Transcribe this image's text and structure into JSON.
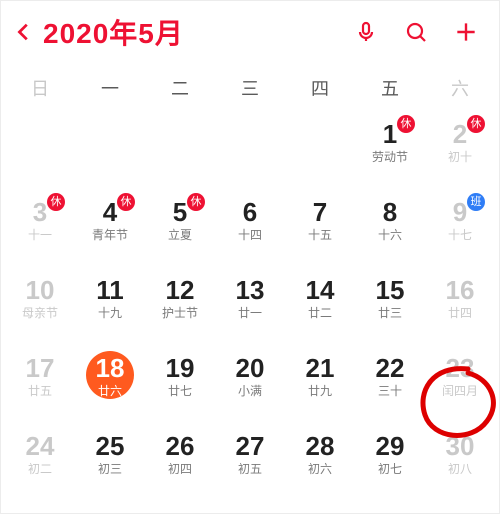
{
  "header": {
    "title": "2020年5月",
    "icons": {
      "back": "chevron-left",
      "mic": "microphone",
      "search": "magnifier",
      "add": "plus"
    }
  },
  "weekdays": [
    "日",
    "一",
    "二",
    "三",
    "四",
    "五",
    "六"
  ],
  "badge_labels": {
    "rest": "休",
    "work": "班"
  },
  "colors": {
    "accent": "#e13",
    "today": "#ff5a1f",
    "work_badge": "#2f7df6"
  },
  "rows": [
    [
      null,
      null,
      null,
      null,
      null,
      {
        "n": "1",
        "s": "劳动节",
        "badge": "rest"
      },
      {
        "n": "2",
        "s": "初十",
        "badge": "rest",
        "muted": true
      }
    ],
    [
      {
        "n": "3",
        "s": "十一",
        "badge": "rest",
        "muted": true
      },
      {
        "n": "4",
        "s": "青年节",
        "badge": "rest"
      },
      {
        "n": "5",
        "s": "立夏",
        "badge": "rest"
      },
      {
        "n": "6",
        "s": "十四"
      },
      {
        "n": "7",
        "s": "十五"
      },
      {
        "n": "8",
        "s": "十六"
      },
      {
        "n": "9",
        "s": "十七",
        "badge": "work",
        "muted": true
      }
    ],
    [
      {
        "n": "10",
        "s": "母亲节",
        "muted": true
      },
      {
        "n": "11",
        "s": "十九"
      },
      {
        "n": "12",
        "s": "护士节"
      },
      {
        "n": "13",
        "s": "廿一"
      },
      {
        "n": "14",
        "s": "廿二"
      },
      {
        "n": "15",
        "s": "廿三"
      },
      {
        "n": "16",
        "s": "廿四",
        "muted": true
      }
    ],
    [
      {
        "n": "17",
        "s": "廿五",
        "muted": true
      },
      {
        "n": "18",
        "s": "廿六",
        "today": true
      },
      {
        "n": "19",
        "s": "廿七"
      },
      {
        "n": "20",
        "s": "小满"
      },
      {
        "n": "21",
        "s": "廿九"
      },
      {
        "n": "22",
        "s": "三十"
      },
      {
        "n": "23",
        "s": "闰四月",
        "muted": true,
        "annotated": true
      }
    ],
    [
      {
        "n": "24",
        "s": "初二",
        "muted": true
      },
      {
        "n": "25",
        "s": "初三"
      },
      {
        "n": "26",
        "s": "初四"
      },
      {
        "n": "27",
        "s": "初五"
      },
      {
        "n": "28",
        "s": "初六"
      },
      {
        "n": "29",
        "s": "初七"
      },
      {
        "n": "30",
        "s": "初八",
        "muted": true
      }
    ]
  ]
}
